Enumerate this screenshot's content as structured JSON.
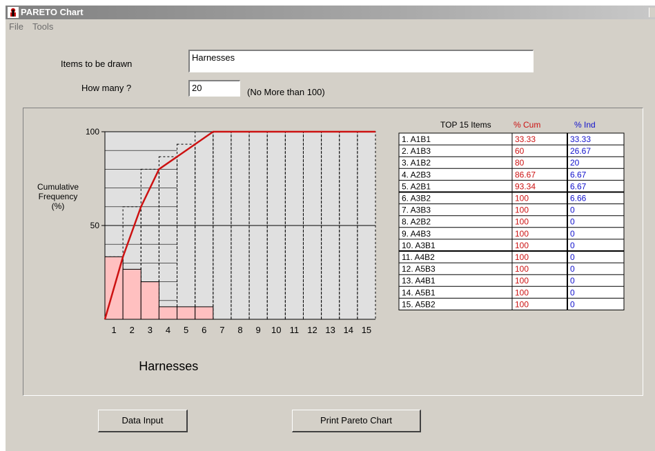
{
  "window": {
    "title": "PARETO Chart"
  },
  "menu": {
    "file": "File",
    "tools": "Tools"
  },
  "form": {
    "items_label": "Items to be drawn",
    "items_value": "Harnesses",
    "howmany_label": "How many ?",
    "howmany_value": "20",
    "howmany_note": "(No More than 100)"
  },
  "chart_data": {
    "type": "bar",
    "categories": [
      "1",
      "2",
      "3",
      "4",
      "5",
      "6",
      "7",
      "8",
      "9",
      "10",
      "11",
      "12",
      "13",
      "14",
      "15"
    ],
    "series": [
      {
        "name": "% Ind",
        "values": [
          33.33,
          26.67,
          20,
          6.67,
          6.67,
          6.66,
          0,
          0,
          0,
          0,
          0,
          0,
          0,
          0,
          0
        ]
      },
      {
        "name": "% Cum",
        "values": [
          33.33,
          60,
          80,
          86.67,
          93.34,
          100,
          100,
          100,
          100,
          100,
          100,
          100,
          100,
          100,
          100
        ]
      }
    ],
    "xlabel": "Harnesses",
    "ylabel": "Cumulative Frequency (%)",
    "ytick_labels": [
      "100",
      "50"
    ],
    "ylim": [
      0,
      100
    ],
    "colors": {
      "bars": "#ffc0c0",
      "cum_line": "#cc1111",
      "background": "#e0e0e0"
    }
  },
  "table": {
    "header_title": "TOP  15 Items",
    "header_cum": "% Cum",
    "header_ind": "% Ind",
    "rows": [
      {
        "item": "1. A1B1",
        "cum": "33.33",
        "ind": "33.33"
      },
      {
        "item": "2. A1B3",
        "cum": "60",
        "ind": "26.67"
      },
      {
        "item": "3. A1B2",
        "cum": "80",
        "ind": "20"
      },
      {
        "item": "4. A2B3",
        "cum": "86.67",
        "ind": "6.67"
      },
      {
        "item": "5. A2B1",
        "cum": "93.34",
        "ind": "6.67"
      },
      {
        "item": "6. A3B2",
        "cum": "100",
        "ind": "6.66"
      },
      {
        "item": "7. A3B3",
        "cum": "100",
        "ind": "0"
      },
      {
        "item": "8. A2B2",
        "cum": "100",
        "ind": "0"
      },
      {
        "item": "9. A4B3",
        "cum": "100",
        "ind": "0"
      },
      {
        "item": "10. A3B1",
        "cum": "100",
        "ind": "0"
      },
      {
        "item": "11. A4B2",
        "cum": "100",
        "ind": "0"
      },
      {
        "item": "12. A5B3",
        "cum": "100",
        "ind": "0"
      },
      {
        "item": "13. A4B1",
        "cum": "100",
        "ind": "0"
      },
      {
        "item": "14. A5B1",
        "cum": "100",
        "ind": "0"
      },
      {
        "item": "15. A5B2",
        "cum": "100",
        "ind": "0"
      }
    ],
    "colors": {
      "cum": "#cc1111",
      "ind": "#1111cc"
    }
  },
  "buttons": {
    "data_input": "Data Input",
    "print": "Print Pareto Chart"
  }
}
